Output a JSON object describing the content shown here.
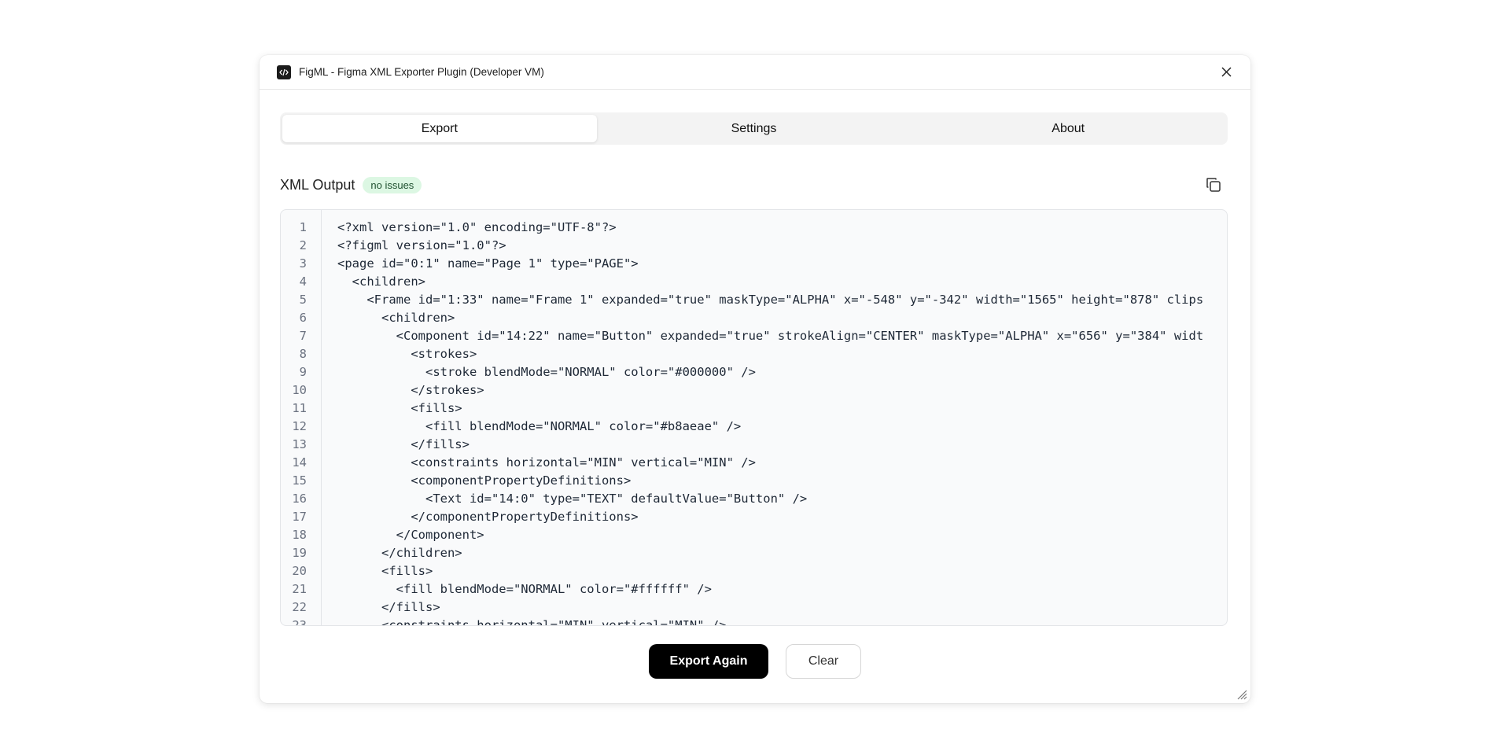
{
  "window": {
    "title": "FigML - Figma XML Exporter Plugin (Developer VM)"
  },
  "tabs": [
    {
      "label": "Export",
      "active": true
    },
    {
      "label": "Settings",
      "active": false
    },
    {
      "label": "About",
      "active": false
    }
  ],
  "output": {
    "title": "XML Output",
    "status_badge": "no issues",
    "badge_color": "#dcf7e3"
  },
  "code": {
    "lines": [
      {
        "n": "1",
        "text": "<?xml version=\"1.0\" encoding=\"UTF-8\"?>"
      },
      {
        "n": "2",
        "text": "<?figml version=\"1.0\"?>"
      },
      {
        "n": "3",
        "text": "<page id=\"0:1\" name=\"Page 1\" type=\"PAGE\">"
      },
      {
        "n": "4",
        "text": "  <children>"
      },
      {
        "n": "5",
        "text": "    <Frame id=\"1:33\" name=\"Frame 1\" expanded=\"true\" maskType=\"ALPHA\" x=\"-548\" y=\"-342\" width=\"1565\" height=\"878\" clips"
      },
      {
        "n": "6",
        "text": "      <children>"
      },
      {
        "n": "7",
        "text": "        <Component id=\"14:22\" name=\"Button\" expanded=\"true\" strokeAlign=\"CENTER\" maskType=\"ALPHA\" x=\"656\" y=\"384\" widt"
      },
      {
        "n": "8",
        "text": "          <strokes>"
      },
      {
        "n": "9",
        "text": "            <stroke blendMode=\"NORMAL\" color=\"#000000\" />"
      },
      {
        "n": "10",
        "text": "          </strokes>"
      },
      {
        "n": "11",
        "text": "          <fills>"
      },
      {
        "n": "12",
        "text": "            <fill blendMode=\"NORMAL\" color=\"#b8aeae\" />"
      },
      {
        "n": "13",
        "text": "          </fills>"
      },
      {
        "n": "14",
        "text": "          <constraints horizontal=\"MIN\" vertical=\"MIN\" />"
      },
      {
        "n": "15",
        "text": "          <componentPropertyDefinitions>"
      },
      {
        "n": "16",
        "text": "            <Text id=\"14:0\" type=\"TEXT\" defaultValue=\"Button\" />"
      },
      {
        "n": "17",
        "text": "          </componentPropertyDefinitions>"
      },
      {
        "n": "18",
        "text": "        </Component>"
      },
      {
        "n": "19",
        "text": "      </children>"
      },
      {
        "n": "20",
        "text": "      <fills>"
      },
      {
        "n": "21",
        "text": "        <fill blendMode=\"NORMAL\" color=\"#ffffff\" />"
      },
      {
        "n": "22",
        "text": "      </fills>"
      },
      {
        "n": "23",
        "text": "      <constraints horizontal=\"MIN\" vertical=\"MIN\" />"
      }
    ]
  },
  "actions": {
    "export_again": "Export Again",
    "clear": "Clear"
  },
  "icons": {
    "logo": "code-icon",
    "close": "close-icon",
    "copy": "copy-icon",
    "resize": "resize-handle-icon"
  }
}
